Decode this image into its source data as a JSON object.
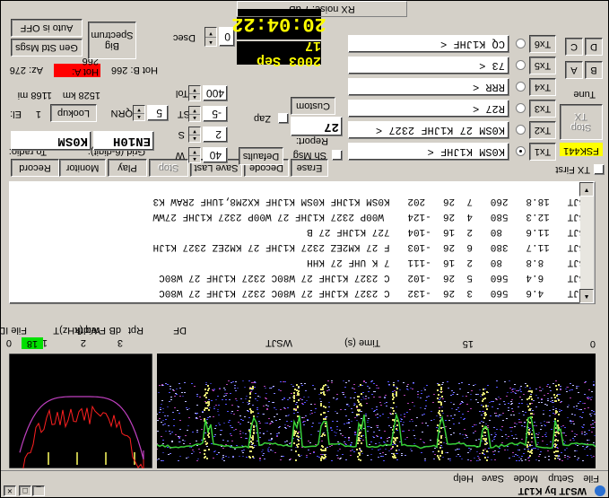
{
  "window": {
    "title": "WSJT    by K1JT",
    "controls": [
      "_",
      "□",
      "×"
    ],
    "menu": [
      "File",
      "Setup",
      "Mode",
      "Save",
      "Help"
    ]
  },
  "waterfall_header": {
    "scale_left": "0",
    "time_label": "Time (s)",
    "mode_label": "WSJT",
    "scale_right": "15",
    "freq_label": "Freq (kHz)",
    "freq_ticks": [
      "0",
      "1",
      "2",
      "3"
    ]
  },
  "controls_row": {
    "file_id_label": "File ID",
    "t_label": "T",
    "width_label": "Width",
    "db_label": "dB",
    "rpt_label": "Rpt",
    "df_label": "DF",
    "t_value": "18"
  },
  "decoded_lines": [
    "WSJT    4.6   560   3  26  -132   C 2327 K1JHF 27 W80C 2327 K1JHF 27 W80C",
    "WSJT    6.4   560   5  26  -102   C 2327 K1JHF 27 W80C 2327 K1JHF 27 W80C",
    "WSJT    8.8    80   2  16  -111   7 K UHF 27 KHH",
    "WSJT   11.7   380   6  26  -103   F 27 KM2EZ 2327 K1JHF 27 KM2EZ 2327 K1JH",
    "WSJT   11.6    80   2  16  -104   727 K1JHF 27 B",
    "WSJT   12.3   580   4  26  -124    W00P 2327 K1JHF 27 W00P 2327 K1JHF 27WW",
    "WSJT   18.8   260   7  26   202   K0SM K1JHF K0SM K1JHF KX2M8,1UHF 2RAW K3"
  ],
  "buttons": {
    "record": "Record",
    "monitor": "Monitor",
    "play": "Play",
    "stop": "Stop",
    "save_last": "Save Last",
    "decode": "Decode",
    "erase": "Erase",
    "lookup": "Lookup",
    "defaults": "Defaults",
    "custom": "Custom",
    "auto": "Auto is OFF",
    "gen_std": "Gen Std Msgs",
    "spectrum": "Spectrum",
    "big": "Big",
    "tx_stop": "TX",
    "tx_stop2": "Stop",
    "tx_select": [
      "Tx1",
      "Tx2",
      "Tx3",
      "Tx4",
      "Tx5",
      "Tx6"
    ],
    "tune": "Tune",
    "letters": [
      "A",
      "B",
      "C",
      "D"
    ]
  },
  "labels": {
    "to_radio": "To radio:",
    "grid": "Grid (6-digit):",
    "el": "El:",
    "el_val": "1",
    "az": "Az: 276",
    "hot_a": "Hot A: 266",
    "hot_b": "Hot B: 266",
    "dist_mi": "1168 mi",
    "dist_km": "1528 km",
    "qrn": "QRN",
    "qrn_val": "5",
    "sync": "ST",
    "sync_val": "-5",
    "s": "S",
    "s_val": "2",
    "w": "W",
    "w_val": "40",
    "tol": "Tol",
    "tol_val": "400",
    "dsec": "Dsec",
    "dsec_val": "0",
    "zap": "Zap",
    "report": "Report:",
    "report_val": "27",
    "sh_msg": "Sh Msg",
    "tx_first": "TX First",
    "rx_noise": "RX noise: 7 dB",
    "fsk": "FSK441"
  },
  "fields": {
    "callsign": "K0SM",
    "grid": "EN10H"
  },
  "clock": {
    "time": "20:04:22",
    "date": "2003 Sep 17"
  },
  "messages": [
    "CQ K1JHF <",
    "73 <",
    "RRR <",
    "R27 <",
    "K0SM 27 K1JHF 2327 <",
    "K0SM K1JHF <"
  ],
  "colors": {
    "waterfall_bg": "#000000",
    "trace": "#38d038",
    "t_badge": "#00e000",
    "hot_a_bg": "#ff0000",
    "fsk_bg": "#ffff00"
  }
}
